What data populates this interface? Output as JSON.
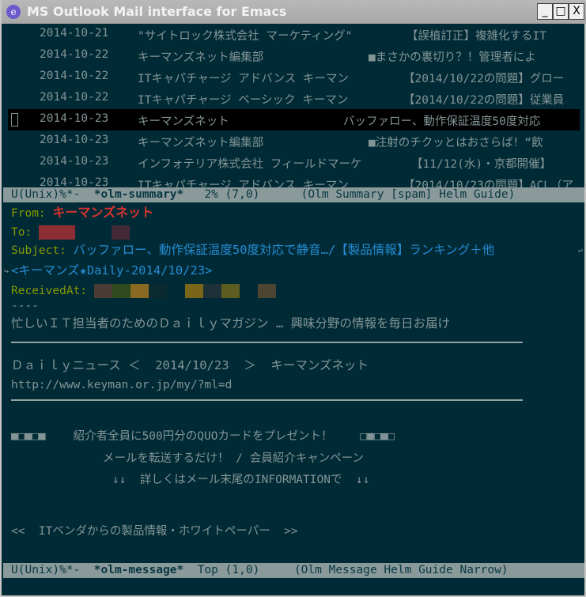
{
  "window": {
    "title": "MS Outlook Mail interface for Emacs",
    "minimize": "_",
    "maximize": "□",
    "close": "X"
  },
  "summary": {
    "rows": [
      {
        "date": "2014-10-21",
        "from": "\"サイトロック株式会社 マーケティング\"",
        "subject": "【誤植訂正】複雑化するIT"
      },
      {
        "date": "2014-10-22",
        "from": "キーマンズネット編集部",
        "subject": "■まさかの裏切り？！管理者によ"
      },
      {
        "date": "2014-10-22",
        "from": "ITキャパチャージ アドバンス キーマン",
        "subject": "【2014/10/22の問題】グロー"
      },
      {
        "date": "2014-10-22",
        "from": "ITキャパチャージ ベーシック キーマン",
        "subject": "【2014/10/22の問題】従業員"
      },
      {
        "date": "2014-10-23",
        "from": "キーマンズネット",
        "subject": "バッファロー、動作保証温度50度対応"
      },
      {
        "date": "2014-10-23",
        "from": "キーマンズネット編集部",
        "subject": "■注射のチクッとはおさらば！“飲"
      },
      {
        "date": "2014-10-23",
        "from": "インフォテリア株式会社 フィールドマーケ",
        "subject": "【11/12(水)・京都開催】"
      },
      {
        "date": "2014-10-23",
        "from": "ITキャパチャージ アドバンス キーマン",
        "subject": "【2014/10/23の問題】ACL（ア"
      }
    ],
    "selected_index": 4,
    "modeline": {
      "status": "U(Unix)%*-  ",
      "buffer": "*olm-summary*",
      "position": "   2% (7,0)",
      "modes": "      (Olm Summary [spam] Helm Guide)"
    }
  },
  "message": {
    "from_label": "From: ",
    "from_value": "キーマンズネット",
    "to_label": "To: ",
    "subject_label": "Subject: ",
    "subject_value": "バッファロー、動作保証温度50度対応で静音…/【製品情報】ランキング＋他",
    "subject_cont": "<キーマンズ★Daily-2014/10/23>",
    "received_label": "ReceivedAt: ",
    "separator": "----",
    "body": [
      "忙しいＩＴ担当者のためのＤａｉｌｙマガジン … 興味分野の情報を毎日お届け",
      "Ｄａｉｌｙニュース ＜  2014/10/23  ＞  キーマンズネット",
      "http://www.keyman.or.jp/my/?ml=d",
      "■□■□■    紹介者全員に500円分のQUOカードをプレゼント！    □■□■□",
      "メールを転送するだけ！ / 会員紹介キャンペーン",
      "↓↓  詳しくはメール末尾のINFORMATIONで  ↓↓",
      "<<  ITベンダからの製品情報・ホワイトペーパー  >>"
    ],
    "modeline": {
      "status": "U(Unix)%*-  ",
      "buffer": "*olm-message*",
      "position": "  Top (1,0)",
      "modes": "     (Olm Message Helm Guide Narrow)"
    }
  },
  "colors": {
    "background": "#002b36",
    "text": "#839496",
    "header": "#859900",
    "from": "#dc322f",
    "subject": "#268bd2",
    "modeline": "#8a9a9a"
  }
}
